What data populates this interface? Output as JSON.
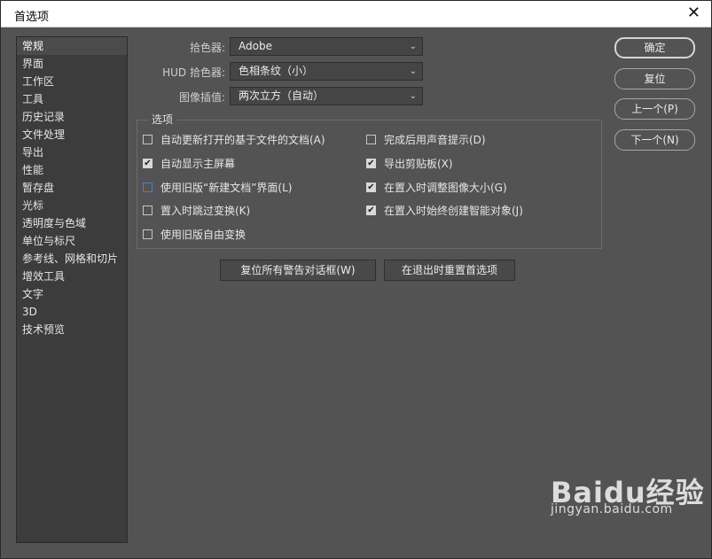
{
  "window": {
    "title": "首选项",
    "close_glyph": "✕"
  },
  "sidebar": {
    "items": [
      {
        "label": "常规"
      },
      {
        "label": "界面"
      },
      {
        "label": "工作区"
      },
      {
        "label": "工具"
      },
      {
        "label": "历史记录"
      },
      {
        "label": "文件处理"
      },
      {
        "label": "导出"
      },
      {
        "label": "性能"
      },
      {
        "label": "暂存盘"
      },
      {
        "label": "光标"
      },
      {
        "label": "透明度与色域"
      },
      {
        "label": "单位与标尺"
      },
      {
        "label": "参考线、网格和切片"
      },
      {
        "label": "增效工具"
      },
      {
        "label": "文字"
      },
      {
        "label": "3D"
      },
      {
        "label": "技术预览"
      }
    ],
    "active_index": 0
  },
  "fields": {
    "color_picker": {
      "label": "拾色器:",
      "value": "Adobe"
    },
    "hud_color_picker": {
      "label": "HUD 拾色器:",
      "value": "色相条纹（小）"
    },
    "image_interpolation": {
      "label": "图像插值:",
      "value": "两次立方（自动）"
    }
  },
  "options": {
    "label": "选项",
    "left": [
      {
        "label": "自动更新打开的基于文件的文档(A)",
        "checked": false
      },
      {
        "label": "自动显示主屏幕",
        "checked": true
      },
      {
        "label": "使用旧版“新建文档”界面(L)",
        "checked": false,
        "focused": true
      },
      {
        "label": "置入时跳过变换(K)",
        "checked": false
      },
      {
        "label": "使用旧版自由变换",
        "checked": false
      }
    ],
    "right": [
      {
        "label": "完成后用声音提示(D)",
        "checked": false
      },
      {
        "label": "导出剪贴板(X)",
        "checked": true
      },
      {
        "label": "在置入时调整图像大小(G)",
        "checked": true
      },
      {
        "label": "在置入时始终创建智能对象(J)",
        "checked": true
      }
    ]
  },
  "actions": {
    "ok": "确定",
    "reset": "复位",
    "prev": "上一个(P)",
    "next": "下一个(N)",
    "reset_warnings": "复位所有警告对话框(W)",
    "reset_on_quit": "在退出时重置首选项"
  },
  "watermark": {
    "brand": "Baidu经验",
    "url": "jingyan.baidu.com"
  },
  "icons": {
    "chevron": "chevron-down-icon",
    "check": "checkmark-icon",
    "close": "close-icon"
  }
}
